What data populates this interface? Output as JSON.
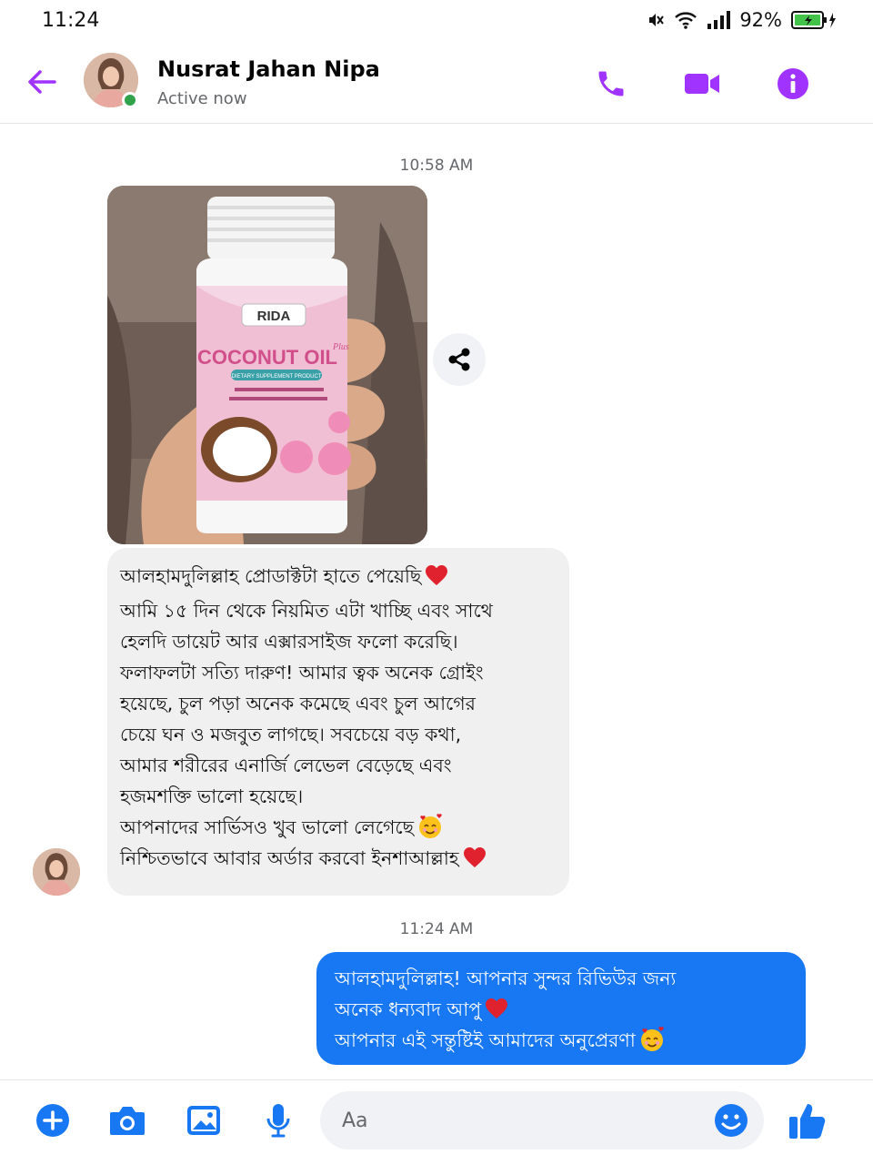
{
  "status_bar": {
    "time": "11:24",
    "battery": "92%",
    "icons": [
      "mute-icon",
      "wifi-icon",
      "signal-icon",
      "battery-charging-icon"
    ]
  },
  "header": {
    "contact_name": "Nusrat Jahan Nipa",
    "contact_status": "Active now",
    "icons": [
      "back-arrow-icon",
      "phone-icon",
      "video-camera-icon",
      "info-icon"
    ],
    "accent_color": "#a033ff"
  },
  "chat": {
    "timestamp_1": "10:58 AM",
    "photo": {
      "label_brand": "RIDA",
      "label_product": "COCONUT OIL",
      "label_plus": "Plus",
      "label_subtitle": "DIETARY SUPPLEMENT PRODUCT"
    },
    "incoming_message": {
      "lines": [
        "আলহামদুলিল্লাহ প্রোডাক্টটা হাতে পেয়েছি",
        "আমি ১৫ দিন থেকে নিয়মিত এটা খাচ্ছি এবং সাথে",
        "হেলদি ডায়েট আর এক্সারসাইজ ফলো করেছি।",
        "ফলাফলটা সত্যি দারুণ! আমার ত্বক অনেক গ্রোইং",
        "হয়েছে, চুল পড়া অনেক কমেছে এবং চুল আগের",
        "চেয়ে ঘন ও মজবুত লাগছে। সবচেয়ে বড় কথা,",
        "আমার শরীরের এনার্জি লেভেল বেড়েছে এবং",
        "হজমশক্তি ভালো হয়েছে।",
        "আপনাদের সার্ভিসও খুব ভালো লেগেছে",
        "নিশ্চিতভাবে আবার অর্ডার করবো ইনশাআল্লাহ"
      ]
    },
    "timestamp_2": "11:24 AM",
    "outgoing_message": {
      "lines": [
        "আলহামদুলিল্লাহ! আপনার সুন্দর রিভিউর জন্য",
        "অনেক ধন্যবাদ আপু",
        "আপনার এই সন্তুষ্টিই আমাদের অনুপ্রেরণা"
      ],
      "bubble_color": "#1877f2"
    }
  },
  "composer": {
    "placeholder": "Aa",
    "icons": [
      "plus-icon",
      "camera-icon",
      "image-icon",
      "microphone-icon",
      "emoji-icon",
      "thumbs-up-icon"
    ],
    "accent_color": "#1877f2"
  }
}
